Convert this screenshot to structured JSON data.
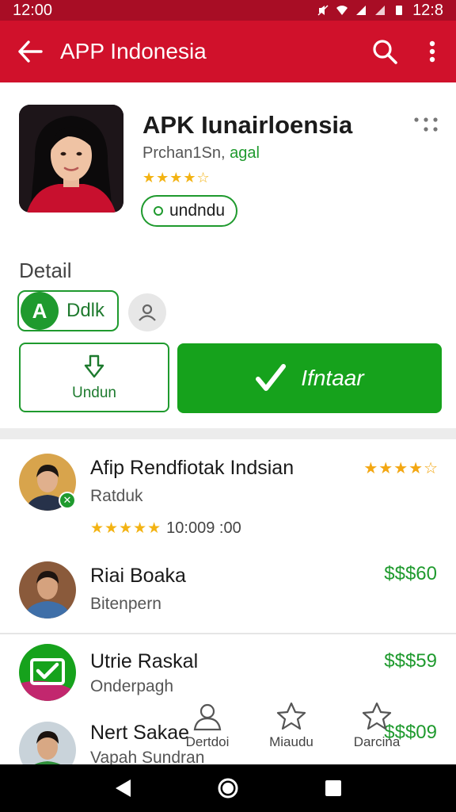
{
  "status_bar": {
    "time": "12:00",
    "clock_right": "12:8"
  },
  "app_bar": {
    "title": "APP Indonesia"
  },
  "app": {
    "name": "APK Iunairloensia",
    "developer": "Prchan1Sn,",
    "category": "agal",
    "stars": "★★★★☆",
    "pill_label": "undndu"
  },
  "detail": {
    "label": "Detail",
    "chip_letter": "A",
    "chip_label": "Ddlk"
  },
  "actions": {
    "download_label": "Undun",
    "install_label": "Ifntaar"
  },
  "list": [
    {
      "title": "Afip Rendfiotak Indsian",
      "subtitle": "Ratduk",
      "rating": "★★★★☆",
      "stars": "★★★★★",
      "meta": "10:009 :00"
    },
    {
      "title": "Riai Boaka",
      "subtitle": "Bitenpern",
      "price": "$$$60"
    },
    {
      "title": "Utrie Raskal",
      "subtitle": "Onderpagh",
      "price": "$$$59"
    },
    {
      "title": "Nert Sakae",
      "subtitle": "Vapah Sundran",
      "price": "$$$09"
    }
  ],
  "bottom_tabs": [
    {
      "label": "Dertdoi",
      "icon": "person-icon"
    },
    {
      "label": "Miaudu",
      "icon": "star-outline-icon"
    },
    {
      "label": "Darcina",
      "icon": "star-outline-icon"
    }
  ],
  "colors": {
    "brand_red": "#d0112b",
    "status_red": "#a80d25",
    "accent_green": "#16a21c",
    "star_gold": "#f3b313"
  }
}
